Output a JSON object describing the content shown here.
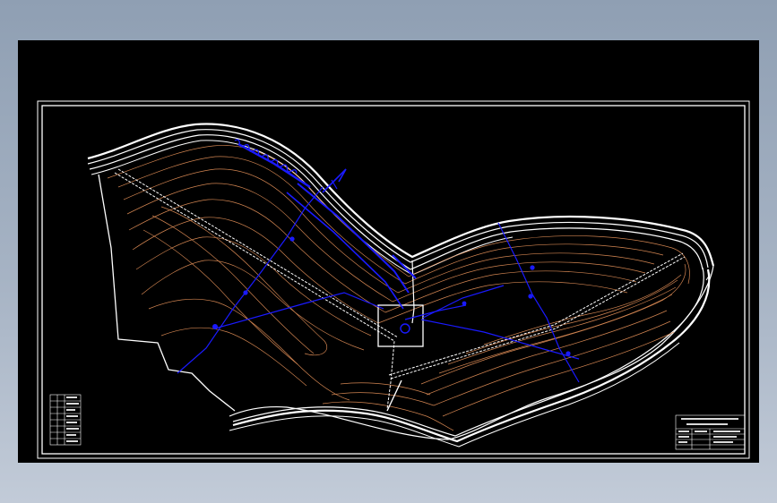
{
  "drawing": {
    "background": "#000000",
    "border_color": "#ffffff",
    "road_color": "#ffffff",
    "contour_color": "#e8935a",
    "pipe_color": "#1a1aff",
    "vertical_labels": [
      "",
      "",
      "",
      "",
      ""
    ]
  },
  "legend_table": {
    "rows": [
      "",
      "",
      "",
      "",
      "",
      "",
      "",
      ""
    ]
  },
  "title_block": {
    "lines": [
      "",
      "",
      "",
      ""
    ]
  }
}
